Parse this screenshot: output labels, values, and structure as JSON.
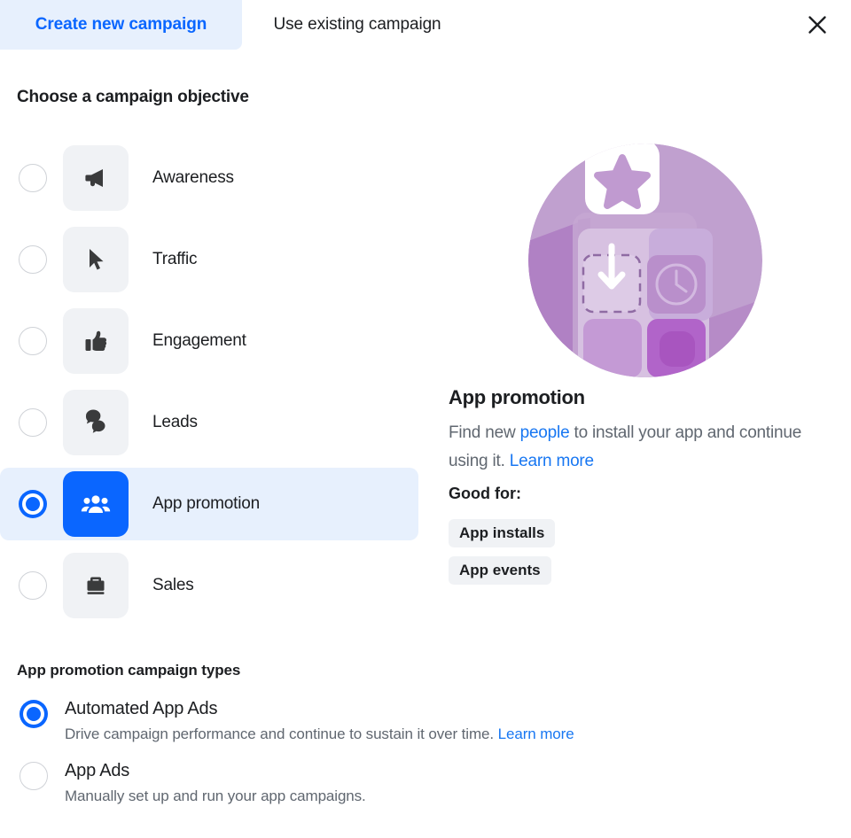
{
  "tabs": [
    {
      "label": "Create new campaign",
      "active": true
    },
    {
      "label": "Use existing campaign",
      "active": false
    }
  ],
  "close_icon": "close-icon",
  "objective_section": {
    "heading": "Choose a campaign objective",
    "options": [
      {
        "label": "Awareness",
        "icon": "megaphone-icon",
        "selected": false
      },
      {
        "label": "Traffic",
        "icon": "cursor-icon",
        "selected": false
      },
      {
        "label": "Engagement",
        "icon": "thumbs-up-icon",
        "selected": false
      },
      {
        "label": "Leads",
        "icon": "chat-bubbles-icon",
        "selected": false
      },
      {
        "label": "App promotion",
        "icon": "people-group-icon",
        "selected": true
      },
      {
        "label": "Sales",
        "icon": "briefcase-icon",
        "selected": false
      }
    ]
  },
  "detail": {
    "illustration": "app-promotion-illustration",
    "title": "App promotion",
    "desc_part1": "Find new ",
    "desc_link1": "people",
    "desc_part2": " to install your app and continue using it. ",
    "desc_link2": "Learn more",
    "good_for_label": "Good for:",
    "chips": [
      "App installs",
      "App events"
    ]
  },
  "campaign_types": {
    "heading": "App promotion campaign types",
    "options": [
      {
        "title": "Automated App Ads",
        "desc": "Drive campaign performance and continue to sustain it over time. ",
        "link": "Learn more",
        "selected": true
      },
      {
        "title": "App Ads",
        "desc": "Manually set up and run your app campaigns.",
        "link": "",
        "selected": false
      }
    ]
  },
  "colors": {
    "accent_blue": "#0a66ff",
    "link_blue": "#1877f2",
    "selected_row_bg": "#e7f0fd",
    "icon_box_bg": "#f0f2f5",
    "text_primary": "#1c1e21",
    "text_secondary": "#606770",
    "illustration_purple": "#b48ec4"
  }
}
